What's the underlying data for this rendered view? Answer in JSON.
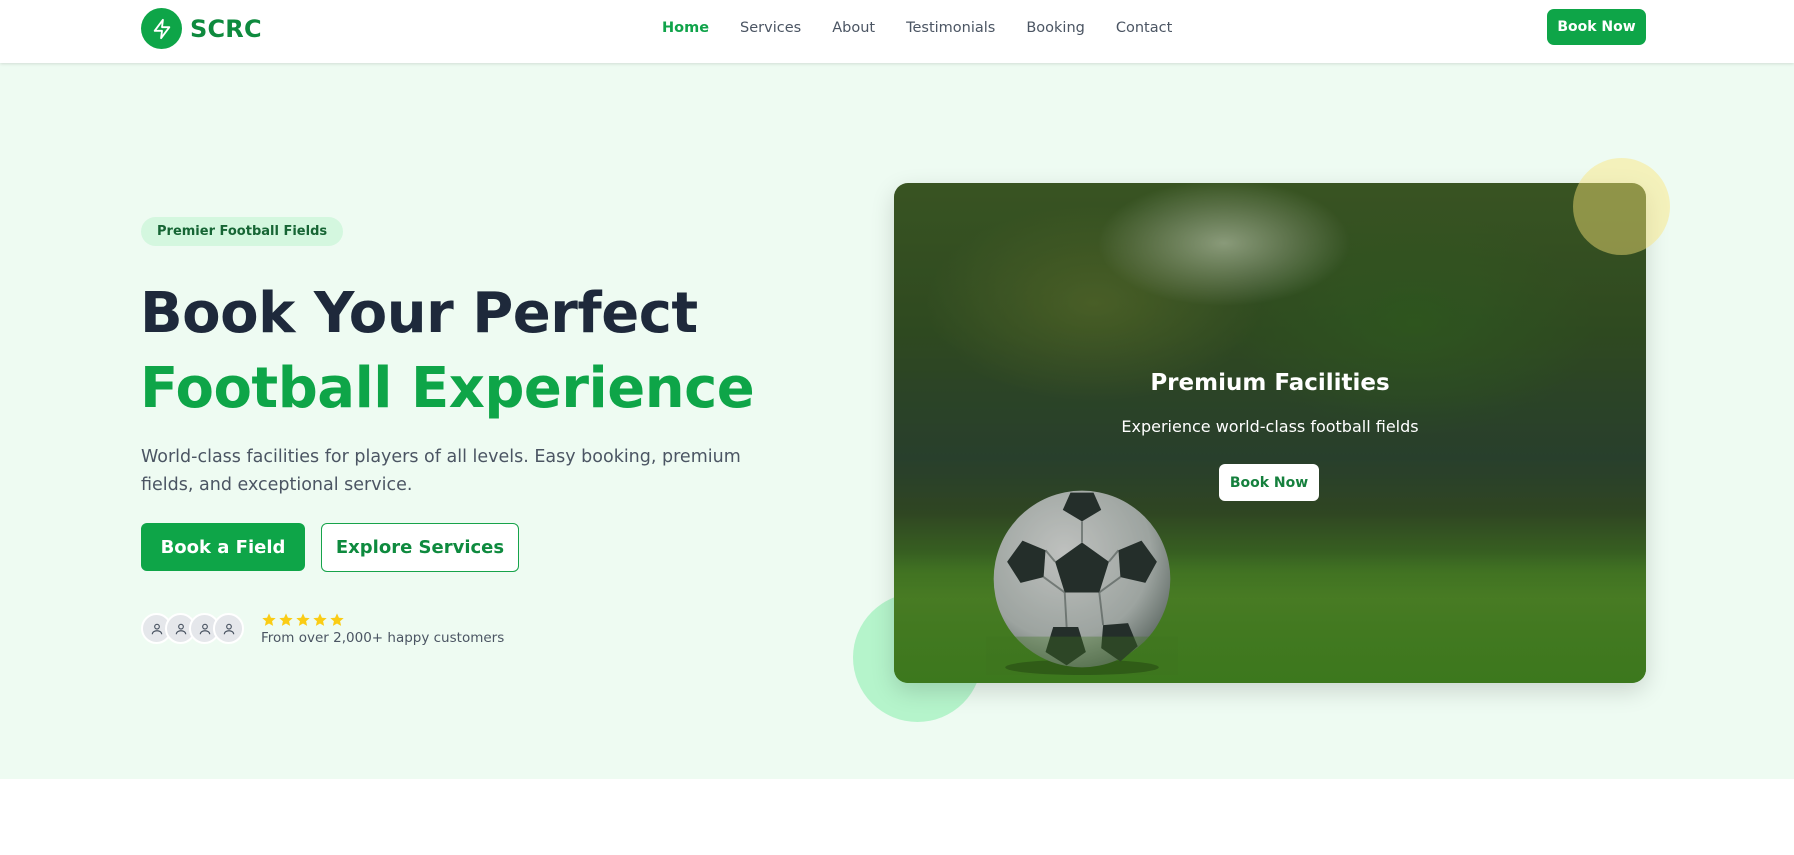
{
  "brand": {
    "name": "SCRC",
    "logo_icon": "lightning-bolt-icon",
    "accent": "#0ea548"
  },
  "nav": {
    "links": [
      {
        "label": "Home",
        "active": true
      },
      {
        "label": "Services",
        "active": false
      },
      {
        "label": "About",
        "active": false
      },
      {
        "label": "Testimonials",
        "active": false
      },
      {
        "label": "Booking",
        "active": false
      },
      {
        "label": "Contact",
        "active": false
      }
    ],
    "cta_label": "Book Now"
  },
  "hero": {
    "badge": "Premier Football Fields",
    "headline_line1": "Book Your Perfect",
    "headline_line2": "Football Experience",
    "description": "World-class facilities for players of all levels. Easy booking, premium fields, and exceptional service.",
    "primary_button": "Book a Field",
    "secondary_button": "Explore Services",
    "rating_stars": 5,
    "customers_text": "From over 2,000+ happy customers",
    "avatar_count": 4
  },
  "feature_card": {
    "title": "Premium Facilities",
    "subtitle": "Experience world-class football fields",
    "button": "Book Now"
  },
  "colors": {
    "green": "#0ea548",
    "dark_text": "#1e293b",
    "hero_bg": "#eefbf2",
    "star": "#facc15"
  }
}
